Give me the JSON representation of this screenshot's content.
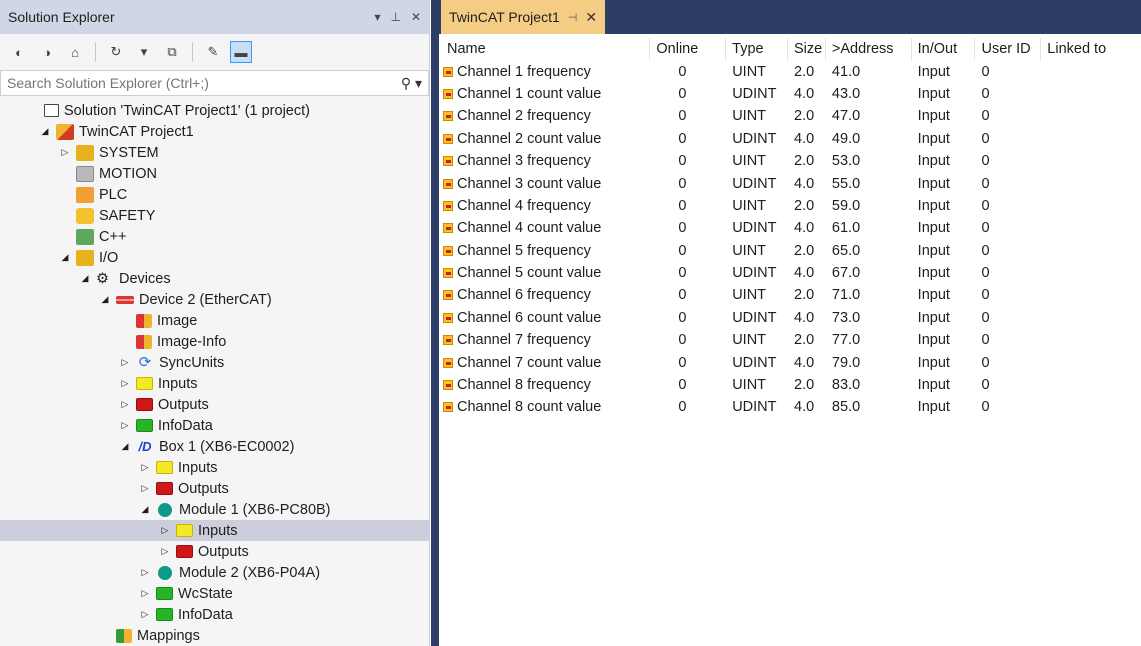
{
  "solution_explorer": {
    "title": "Solution Explorer",
    "search_placeholder": "Search Solution Explorer (Ctrl+;)",
    "tree": [
      {
        "label": "Solution 'TwinCAT Project1' (1 project)",
        "icon": "solution-icon",
        "indent": 0,
        "arrow": ""
      },
      {
        "label": "TwinCAT Project1",
        "icon": "project-icon",
        "indent": 1,
        "arrow": "◢"
      },
      {
        "label": "SYSTEM",
        "icon": "system-icon",
        "indent": 2,
        "arrow": "▷"
      },
      {
        "label": "MOTION",
        "icon": "motion-icon",
        "indent": 2,
        "arrow": ""
      },
      {
        "label": "PLC",
        "icon": "plc-icon",
        "indent": 2,
        "arrow": ""
      },
      {
        "label": "SAFETY",
        "icon": "safety-icon",
        "indent": 2,
        "arrow": ""
      },
      {
        "label": "C++",
        "icon": "cpp-icon",
        "indent": 2,
        "arrow": ""
      },
      {
        "label": "I/O",
        "icon": "io-icon",
        "indent": 2,
        "arrow": "◢"
      },
      {
        "label": "Devices",
        "icon": "devices-icon",
        "indent": 3,
        "arrow": "◢"
      },
      {
        "label": "Device 2 (EtherCAT)",
        "icon": "ethercat-device-icon",
        "indent": 4,
        "arrow": "◢"
      },
      {
        "label": "Image",
        "icon": "image-icon",
        "indent": 5,
        "arrow": ""
      },
      {
        "label": "Image-Info",
        "icon": "image-info-icon",
        "indent": 5,
        "arrow": ""
      },
      {
        "label": "SyncUnits",
        "icon": "sync-units-icon",
        "indent": 5,
        "arrow": "▷"
      },
      {
        "label": "Inputs",
        "icon": "inputs-icon",
        "indent": 5,
        "arrow": "▷"
      },
      {
        "label": "Outputs",
        "icon": "outputs-icon",
        "indent": 5,
        "arrow": "▷"
      },
      {
        "label": "InfoData",
        "icon": "infodata-icon",
        "indent": 5,
        "arrow": "▷"
      },
      {
        "label": "Box 1 (XB6-EC0002)",
        "icon": "box-icon",
        "indent": 5,
        "arrow": "◢"
      },
      {
        "label": "Inputs",
        "icon": "inputs-icon",
        "indent": 6,
        "arrow": "▷"
      },
      {
        "label": "Outputs",
        "icon": "outputs-icon",
        "indent": 6,
        "arrow": "▷"
      },
      {
        "label": "Module 1 (XB6-PC80B)",
        "icon": "module-icon",
        "indent": 6,
        "arrow": "◢"
      },
      {
        "label": "Inputs",
        "icon": "inputs-icon",
        "indent": 7,
        "arrow": "▷",
        "selected": true
      },
      {
        "label": "Outputs",
        "icon": "outputs-icon",
        "indent": 7,
        "arrow": "▷"
      },
      {
        "label": "Module 2 (XB6-P04A)",
        "icon": "module-icon",
        "indent": 6,
        "arrow": "▷"
      },
      {
        "label": "WcState",
        "icon": "wcstate-icon",
        "indent": 6,
        "arrow": "▷"
      },
      {
        "label": "InfoData",
        "icon": "infodata-icon",
        "indent": 6,
        "arrow": "▷"
      },
      {
        "label": "Mappings",
        "icon": "mappings-icon",
        "indent": 4,
        "arrow": ""
      }
    ]
  },
  "document": {
    "tab_label": "TwinCAT Project1",
    "columns": [
      "Name",
      "Online",
      "Type",
      "Size",
      ">Address",
      "In/Out",
      "User ID",
      "Linked to"
    ],
    "rows": [
      {
        "name": "Channel 1 frequency",
        "online": "0",
        "type": "UINT",
        "size": "2.0",
        "address": "41.0",
        "inout": "Input",
        "uid": "0",
        "linked": ""
      },
      {
        "name": "Channel 1 count value",
        "online": "0",
        "type": "UDINT",
        "size": "4.0",
        "address": "43.0",
        "inout": "Input",
        "uid": "0",
        "linked": ""
      },
      {
        "name": "Channel 2 frequency",
        "online": "0",
        "type": "UINT",
        "size": "2.0",
        "address": "47.0",
        "inout": "Input",
        "uid": "0",
        "linked": ""
      },
      {
        "name": "Channel 2 count value",
        "online": "0",
        "type": "UDINT",
        "size": "4.0",
        "address": "49.0",
        "inout": "Input",
        "uid": "0",
        "linked": ""
      },
      {
        "name": "Channel 3 frequency",
        "online": "0",
        "type": "UINT",
        "size": "2.0",
        "address": "53.0",
        "inout": "Input",
        "uid": "0",
        "linked": ""
      },
      {
        "name": "Channel 3 count value",
        "online": "0",
        "type": "UDINT",
        "size": "4.0",
        "address": "55.0",
        "inout": "Input",
        "uid": "0",
        "linked": ""
      },
      {
        "name": "Channel 4 frequency",
        "online": "0",
        "type": "UINT",
        "size": "2.0",
        "address": "59.0",
        "inout": "Input",
        "uid": "0",
        "linked": ""
      },
      {
        "name": "Channel 4 count value",
        "online": "0",
        "type": "UDINT",
        "size": "4.0",
        "address": "61.0",
        "inout": "Input",
        "uid": "0",
        "linked": ""
      },
      {
        "name": "Channel 5 frequency",
        "online": "0",
        "type": "UINT",
        "size": "2.0",
        "address": "65.0",
        "inout": "Input",
        "uid": "0",
        "linked": ""
      },
      {
        "name": "Channel 5 count value",
        "online": "0",
        "type": "UDINT",
        "size": "4.0",
        "address": "67.0",
        "inout": "Input",
        "uid": "0",
        "linked": ""
      },
      {
        "name": "Channel 6 frequency",
        "online": "0",
        "type": "UINT",
        "size": "2.0",
        "address": "71.0",
        "inout": "Input",
        "uid": "0",
        "linked": ""
      },
      {
        "name": "Channel 6 count value",
        "online": "0",
        "type": "UDINT",
        "size": "4.0",
        "address": "73.0",
        "inout": "Input",
        "uid": "0",
        "linked": ""
      },
      {
        "name": "Channel 7 frequency",
        "online": "0",
        "type": "UINT",
        "size": "2.0",
        "address": "77.0",
        "inout": "Input",
        "uid": "0",
        "linked": ""
      },
      {
        "name": "Channel 7 count value",
        "online": "0",
        "type": "UDINT",
        "size": "4.0",
        "address": "79.0",
        "inout": "Input",
        "uid": "0",
        "linked": ""
      },
      {
        "name": "Channel 8 frequency",
        "online": "0",
        "type": "UINT",
        "size": "2.0",
        "address": "83.0",
        "inout": "Input",
        "uid": "0",
        "linked": ""
      },
      {
        "name": "Channel 8 count value",
        "online": "0",
        "type": "UDINT",
        "size": "4.0",
        "address": "85.0",
        "inout": "Input",
        "uid": "0",
        "linked": ""
      }
    ]
  },
  "colors": {
    "title_bar": "#cfd6e5",
    "tab_active": "#f5cc84",
    "tab_strip": "#2d3e66",
    "selection": "#cccedb"
  }
}
